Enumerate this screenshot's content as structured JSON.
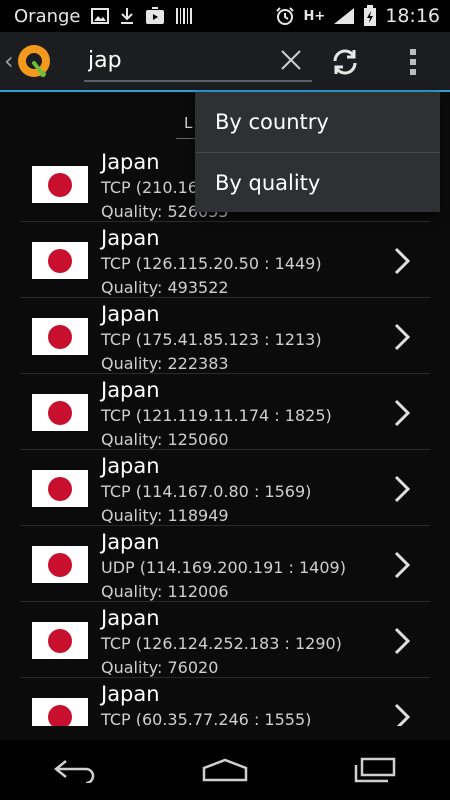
{
  "status_bar": {
    "carrier": "Orange",
    "network": "H+",
    "time": "18:16"
  },
  "search": {
    "value": "jap",
    "placeholder": ""
  },
  "sort_header": {
    "label": "L"
  },
  "dropdown": {
    "items": [
      {
        "label": "By country"
      },
      {
        "label": "By quality"
      }
    ]
  },
  "servers": [
    {
      "country": "Japan",
      "protocol": "TCP (210.16",
      "quality": "Quality: 526055"
    },
    {
      "country": "Japan",
      "protocol": "TCP (126.115.20.50 : 1449)",
      "quality": "Quality: 493522"
    },
    {
      "country": "Japan",
      "protocol": "TCP (175.41.85.123 : 1213)",
      "quality": "Quality: 222383"
    },
    {
      "country": "Japan",
      "protocol": "TCP (121.119.11.174 : 1825)",
      "quality": "Quality: 125060"
    },
    {
      "country": "Japan",
      "protocol": "TCP (114.167.0.80 : 1569)",
      "quality": "Quality: 118949"
    },
    {
      "country": "Japan",
      "protocol": "UDP (114.169.200.191 : 1409)",
      "quality": "Quality: 112006"
    },
    {
      "country": "Japan",
      "protocol": "TCP (126.124.252.183 : 1290)",
      "quality": "Quality: 76020"
    },
    {
      "country": "Japan",
      "protocol": "TCP (60.35.77.246 : 1555)",
      "quality": ""
    }
  ],
  "colors": {
    "accent": "#2ea0d8",
    "flag_red": "#c8102e",
    "logo_orange": "#f39a1e",
    "logo_green": "#6bbf3a"
  },
  "icons": {
    "clear": "close-icon",
    "refresh": "refresh-icon",
    "overflow": "overflow-menu-icon",
    "chevron": "chevron-right-icon",
    "back": "back-icon",
    "home": "home-icon",
    "recents": "recent-apps-icon"
  }
}
